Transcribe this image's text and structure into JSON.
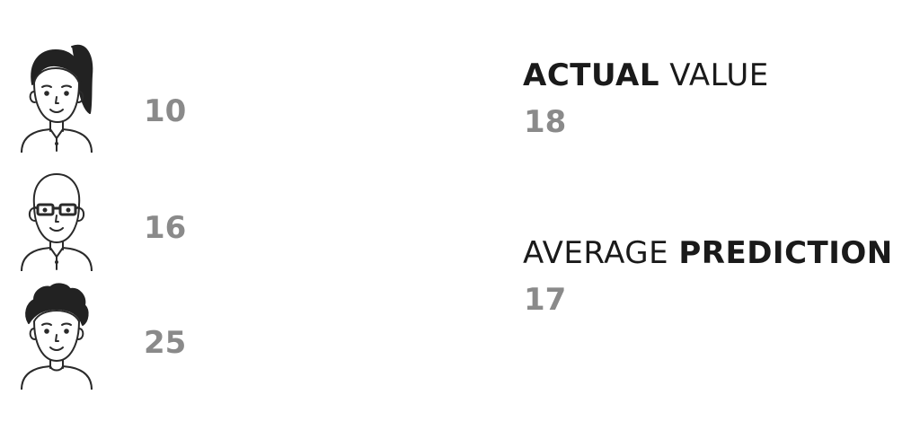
{
  "people": [
    {
      "icon": "woman-ponytail-avatar-icon",
      "prediction": "10"
    },
    {
      "icon": "bald-glasses-man-avatar-icon",
      "prediction": "16"
    },
    {
      "icon": "curly-hair-person-avatar-icon",
      "prediction": "25"
    }
  ],
  "actual": {
    "label_bold": "ACTUAL",
    "label_rest": " VALUE",
    "value": "18"
  },
  "average": {
    "label_rest": "AVERAGE ",
    "label_bold": "PREDICTION",
    "value": "17"
  },
  "colors": {
    "line": "#2a2a2a",
    "hair": "#222222",
    "number": "#8a8a8a",
    "heading": "#1a1a1a"
  }
}
